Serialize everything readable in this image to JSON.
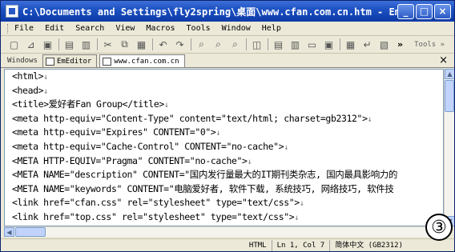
{
  "window": {
    "title": "C:\\Documents and Settings\\fly2spring\\桌面\\www.cfan.com.cn.htm - EmEd..."
  },
  "menu": {
    "items": [
      "File",
      "Edit",
      "Search",
      "View",
      "Macros",
      "Tools",
      "Window",
      "Help"
    ]
  },
  "toolbar": {
    "more": "»",
    "tools_label": "Tools »"
  },
  "tabs": {
    "windows_label": "Windows",
    "items": [
      {
        "label": "EmEditor"
      },
      {
        "label": "www.cfan.com.cn"
      }
    ],
    "close": "×"
  },
  "editor": {
    "lines": [
      "<html>",
      "<head>",
      "<title>爱好者Fan Group</title>",
      "<meta http-equiv=\"Content-Type\" content=\"text/html; charset=gb2312\">",
      "<meta http-equiv=\"Expires\" CONTENT=\"0\">",
      "<meta http-equiv=\"Cache-Control\" CONTENT=\"no-cache\">",
      "<META HTTP-EQUIV=\"Pragma\" CONTENT=\"no-cache\">",
      "<META NAME=\"description\" CONTENT=\"国内发行量最大的IT期刊类杂志, 国内最具影响力的",
      "<META NAME=\"keywords\" CONTENT=\"电脑爱好者, 软件下载, 系统技巧, 网络技巧, 软件技",
      "<link href=\"cfan.css\" rel=\"stylesheet\" type=\"text/css\">",
      "<link href=\"top.css\" rel=\"stylesheet\" type=\"text/css\">"
    ],
    "eol_marker": "↓"
  },
  "status": {
    "mode": "HTML",
    "position": "Ln 1, Col 7",
    "encoding": "简体中文 (GB2312)"
  },
  "badge": {
    "label": "③"
  }
}
